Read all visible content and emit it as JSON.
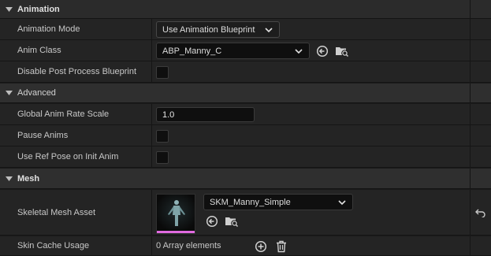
{
  "sections": {
    "animation": {
      "title": "Animation"
    },
    "advanced": {
      "title": "Advanced"
    },
    "mesh": {
      "title": "Mesh"
    }
  },
  "animation": {
    "mode_label": "Animation Mode",
    "mode_value": "Use Animation Blueprint",
    "class_label": "Anim Class",
    "class_value": "ABP_Manny_C",
    "disable_post_label": "Disable Post Process Blueprint",
    "disable_post_checked": false
  },
  "advanced": {
    "rate_label": "Global Anim Rate Scale",
    "rate_value": "1.0",
    "pause_label": "Pause Anims",
    "pause_checked": false,
    "refpose_label": "Use Ref Pose on Init Anim",
    "refpose_checked": false
  },
  "mesh": {
    "asset_label": "Skeletal Mesh Asset",
    "asset_value": "SKM_Manny_Simple",
    "skin_label": "Skin Cache Usage",
    "skin_value": "0 Array elements"
  },
  "icons": {
    "browse": "arrow-left-circle-icon",
    "find": "folder-search-icon",
    "reset": "reset-arrow-icon",
    "add": "plus-circle-icon",
    "delete": "trash-icon"
  },
  "colors": {
    "background": "#1a1a1a",
    "row": "#242424",
    "header": "#2f2f2f",
    "field": "#0f0f0f",
    "thumbnail_accent": "#e06adf"
  }
}
